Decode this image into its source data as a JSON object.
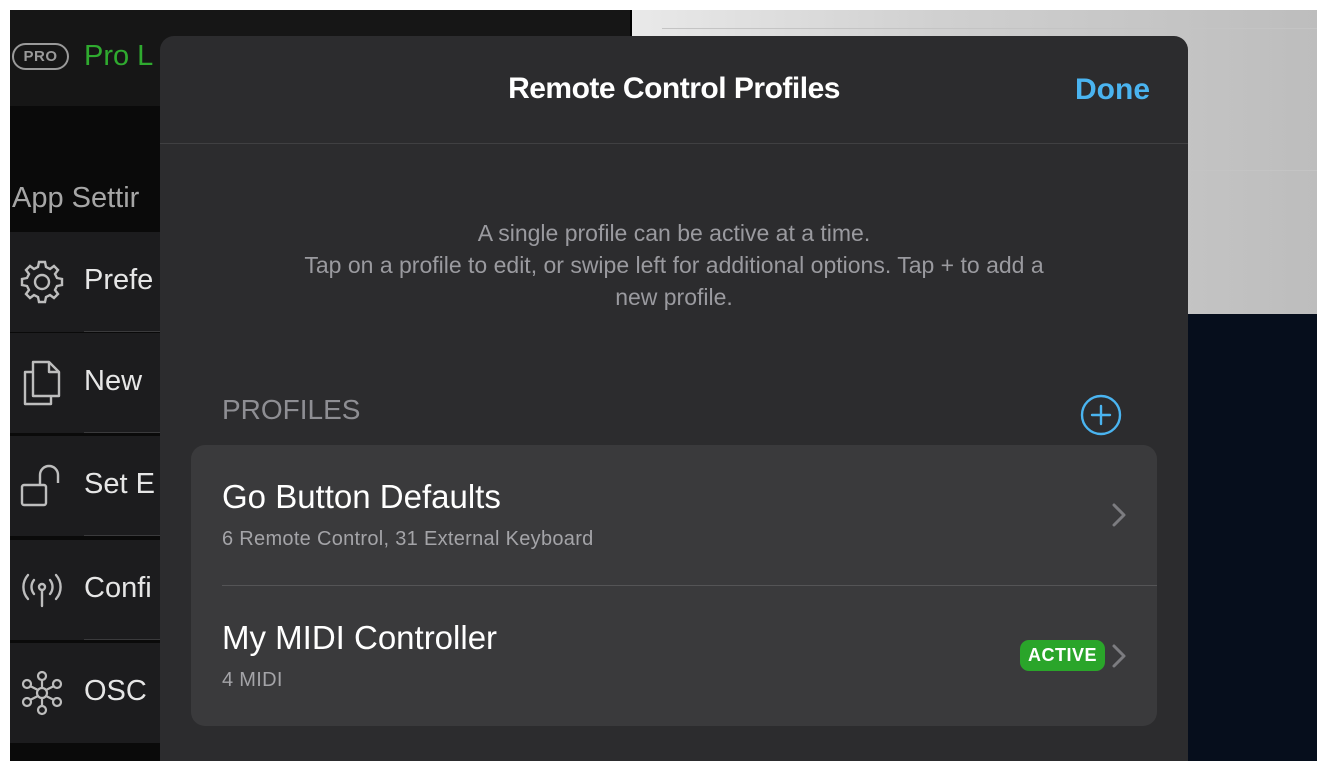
{
  "sidebar": {
    "badge": "PRO",
    "pro_label": "Pro L",
    "section_title": "App Settir",
    "items": [
      {
        "label": "Prefe",
        "icon": "gear-icon"
      },
      {
        "label": "New",
        "icon": "copy-document-icon"
      },
      {
        "label": "Set E",
        "icon": "unlock-icon"
      },
      {
        "label": "Confi",
        "icon": "antenna-icon"
      },
      {
        "label": "OSC",
        "icon": "network-icon"
      }
    ]
  },
  "modal": {
    "title": "Remote Control Profiles",
    "done_label": "Done",
    "description": [
      "A single profile can be active at a time.",
      "Tap on a profile to edit, or swipe left for additional options. Tap + to add a",
      "new profile."
    ],
    "section_header": "PROFILES",
    "add_icon": "plus-circle-icon",
    "profiles": [
      {
        "name": "Go Button Defaults",
        "detail": "6 Remote Control, 31 External Keyboard",
        "active": false
      },
      {
        "name": "My MIDI Controller",
        "detail": "4 MIDI",
        "active": true,
        "badge": "ACTIVE"
      }
    ]
  },
  "colors": {
    "accent": "#4ab4f0",
    "active_badge": "#2aa52a",
    "pro_green": "#2faa2f",
    "modal_bg": "#2c2c2e",
    "list_bg": "#3a3a3c"
  }
}
